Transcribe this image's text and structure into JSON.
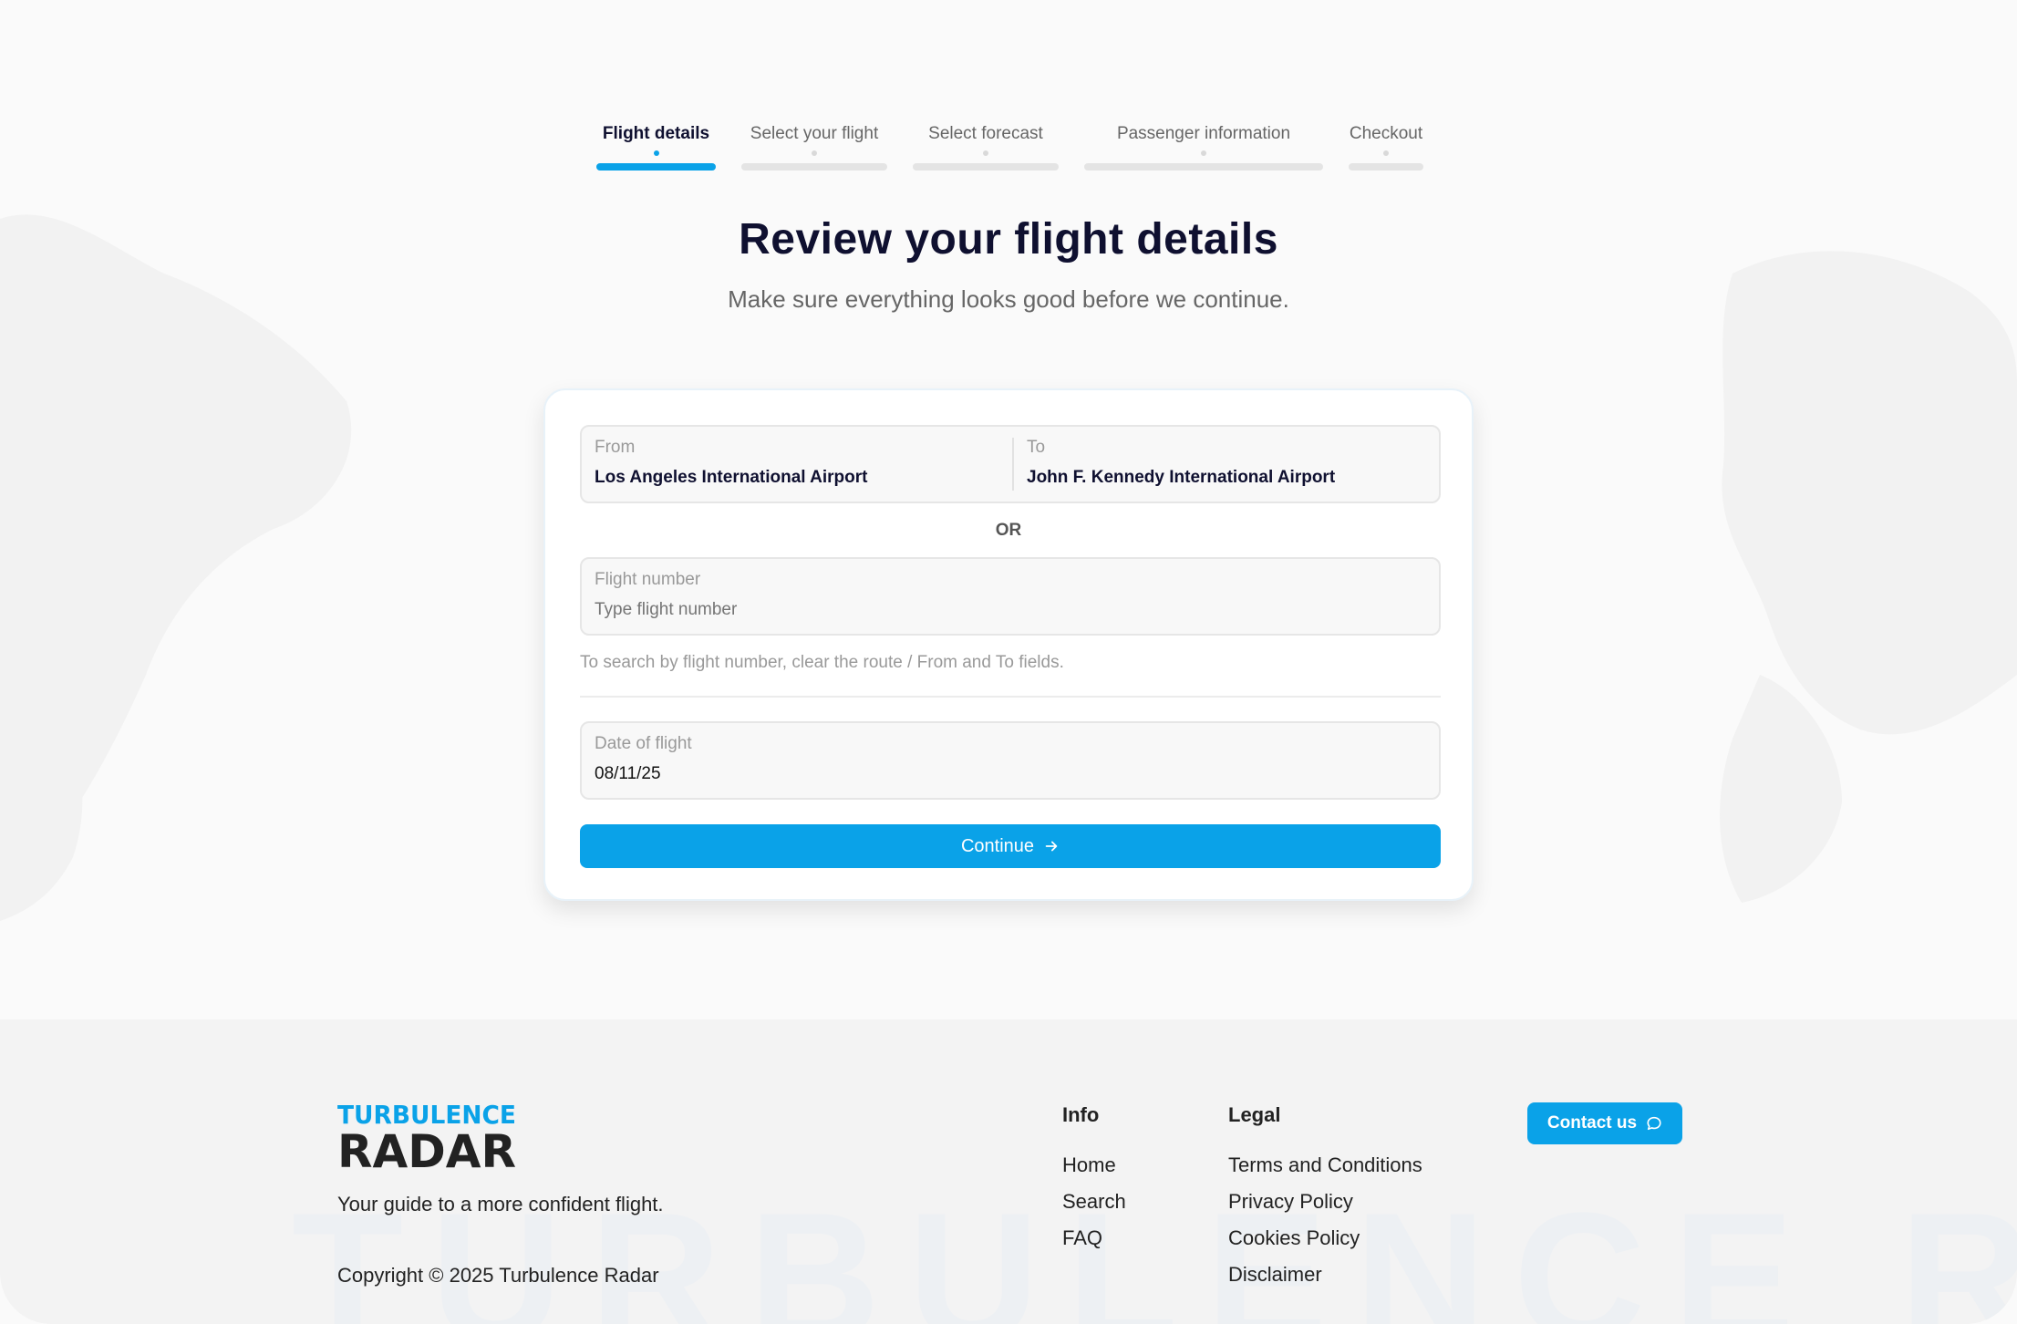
{
  "stepper": {
    "steps": [
      {
        "label": "Flight details",
        "active": true
      },
      {
        "label": "Select your flight",
        "active": false
      },
      {
        "label": "Select forecast",
        "active": false
      },
      {
        "label": "Passenger information",
        "active": false
      },
      {
        "label": "Checkout",
        "active": false
      }
    ]
  },
  "header": {
    "title": "Review your flight details",
    "subtitle": "Make sure everything looks good before we continue."
  },
  "form": {
    "from_label": "From",
    "from_value": "Los Angeles International Airport",
    "to_label": "To",
    "to_value": "John F. Kennedy International Airport",
    "or_text": "OR",
    "flight_number_label": "Flight number",
    "flight_number_placeholder": "Type flight number",
    "hint": "To search by flight number, clear the route / From and To fields.",
    "date_label": "Date of flight",
    "date_value": "08/11/25",
    "continue_label": "Continue",
    "continue_icon": "arrow-right-icon"
  },
  "footer": {
    "logo_top": "TURBULENCE",
    "logo_bottom": "RADAR",
    "tagline": "Your guide to a more confident flight.",
    "copyright": "Copyright © 2025 Turbulence Radar",
    "info_title": "Info",
    "info_links": [
      "Home",
      "Search",
      "FAQ"
    ],
    "legal_title": "Legal",
    "legal_links": [
      "Terms and Conditions",
      "Privacy Policy",
      "Cookies Policy",
      "Disclaimer"
    ],
    "contact_label": "Contact us",
    "contact_icon": "chat-bubble-icon",
    "watermark": "TURBULENCE RADAR"
  },
  "colors": {
    "accent": "#0aa2e8",
    "heading": "#0f1030",
    "background": "#fafafa"
  }
}
